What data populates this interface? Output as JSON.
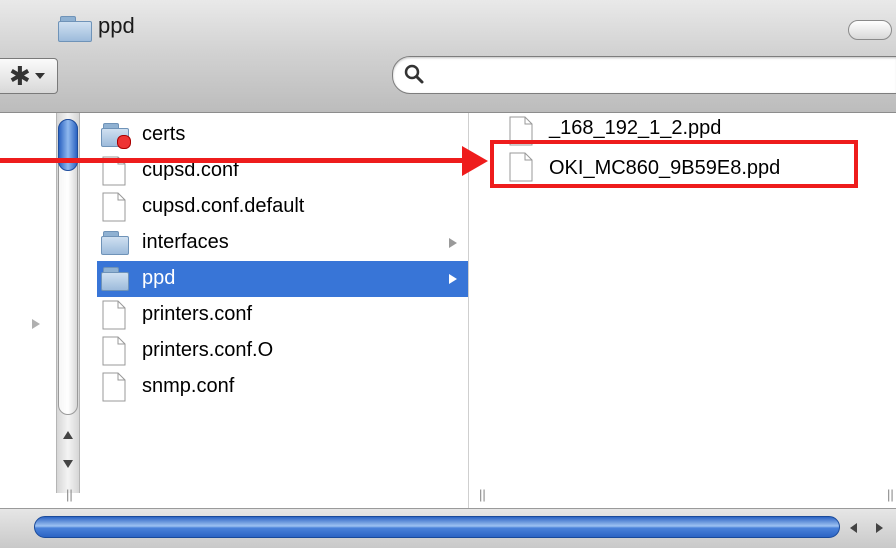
{
  "window": {
    "title": "ppd"
  },
  "toolbar": {
    "action_icon": "gear-icon",
    "search_placeholder": "",
    "search_icon": "magnifier-icon"
  },
  "columns": {
    "column2": {
      "items": [
        {
          "label": "certs",
          "icon": "folder-icon",
          "selected": false,
          "has_children": false
        },
        {
          "label": "cupsd.conf",
          "icon": "document-icon",
          "selected": false,
          "has_children": false
        },
        {
          "label": "cupsd.conf.default",
          "icon": "document-icon",
          "selected": false,
          "has_children": false
        },
        {
          "label": "interfaces",
          "icon": "folder-icon",
          "selected": false,
          "has_children": true
        },
        {
          "label": "ppd",
          "icon": "folder-icon",
          "selected": true,
          "has_children": true
        },
        {
          "label": "printers.conf",
          "icon": "document-icon",
          "selected": false,
          "has_children": false
        },
        {
          "label": "printers.conf.O",
          "icon": "document-icon",
          "selected": false,
          "has_children": false
        },
        {
          "label": "snmp.conf",
          "icon": "document-icon",
          "selected": false,
          "has_children": false
        }
      ]
    },
    "column3": {
      "items": [
        {
          "label": "_168_192_1_2.ppd",
          "icon": "document-icon"
        },
        {
          "label": "OKI_MC860_9B59E8.ppd",
          "icon": "document-icon",
          "highlighted": true
        }
      ]
    }
  },
  "colors": {
    "selection": "#3875d7",
    "highlight": "#ee1c1c"
  }
}
